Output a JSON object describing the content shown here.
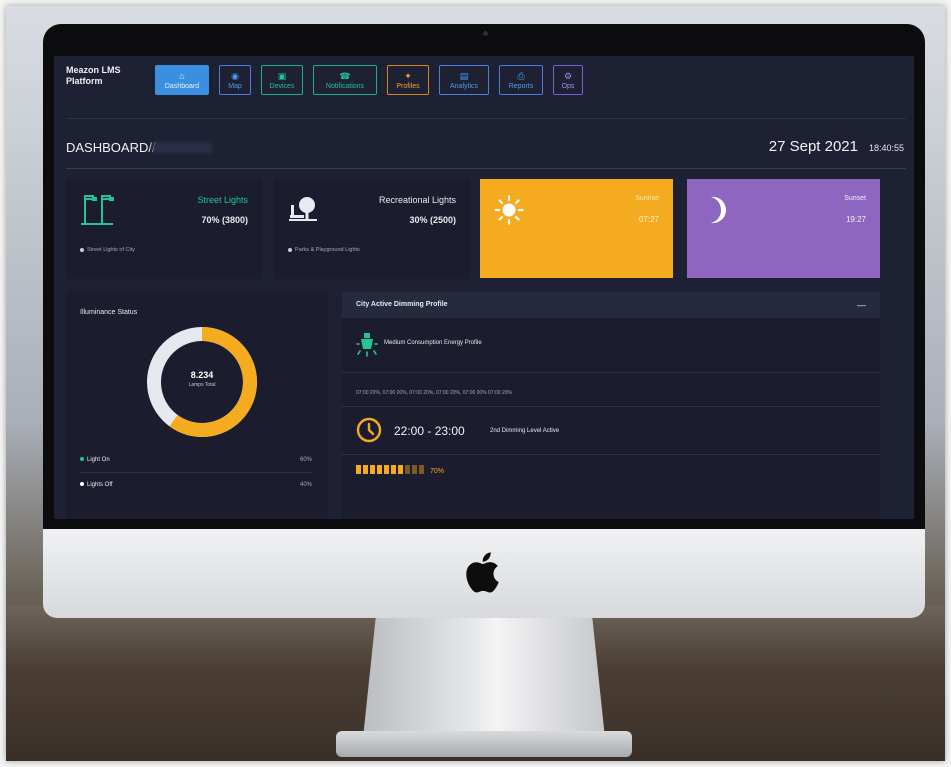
{
  "app": {
    "brand": "Meazon LMS Platform"
  },
  "nav": {
    "items": [
      {
        "label": "Dashboard",
        "icon": "home-icon"
      },
      {
        "label": "Map",
        "icon": "map-pin-icon"
      },
      {
        "label": "Devices",
        "icon": "devices-icon"
      },
      {
        "label": "Notifications",
        "icon": "notification-icon"
      },
      {
        "label": "Profiles",
        "icon": "profiles-icon"
      },
      {
        "label": "Analytics",
        "icon": "analytics-icon"
      },
      {
        "label": "Reports",
        "icon": "print-icon"
      },
      {
        "label": "Ops",
        "icon": "gear-icon"
      }
    ],
    "active": "Dashboard"
  },
  "header": {
    "title": "DASHBOARD//",
    "date": "27 Sept 2021",
    "time": "18:40:55"
  },
  "cards": {
    "street": {
      "title": "Street Lights",
      "value": "70% (3800)",
      "footnote": "Street Lights of City"
    },
    "recreational": {
      "title": "Recreational Lights",
      "value": "30% (2500)",
      "footnote": "Parks & Playground Lights"
    },
    "sunrise": {
      "label": "Sunrise",
      "value": "07:27"
    },
    "sunset": {
      "label": "Sunset",
      "value": "19:27"
    }
  },
  "illuminance": {
    "title": "Illuminance Status",
    "total": "8.234",
    "total_label": "Lamps Total",
    "legend": [
      {
        "label": "Light On",
        "pct": "60%",
        "fraction": 0.6,
        "color": "#f5ab1f"
      },
      {
        "label": "Lights Off",
        "pct": "40%",
        "fraction": 0.4,
        "color": "#e6e8ef"
      }
    ]
  },
  "dimming": {
    "title": "City Active Dimming Profile",
    "collapse": "—",
    "profile_name": "Medium Consumption Energy Profile",
    "schedule": "07:00 20%, 07:00 20%, 07:00 20%, 07:00 20%, 07:00 20% 07:00 20%",
    "time_range": "22:00 - 23:00",
    "level_text": "2nd Dimming Level Active",
    "level_pct": "70%",
    "level_fraction": 0.7,
    "level_segments": 10
  },
  "colors": {
    "accent_orange": "#f5ab1f",
    "accent_purple": "#8f66bf",
    "accent_green": "#21c596",
    "accent_blue": "#3a8fe0",
    "panel_bg": "#1e2033"
  }
}
